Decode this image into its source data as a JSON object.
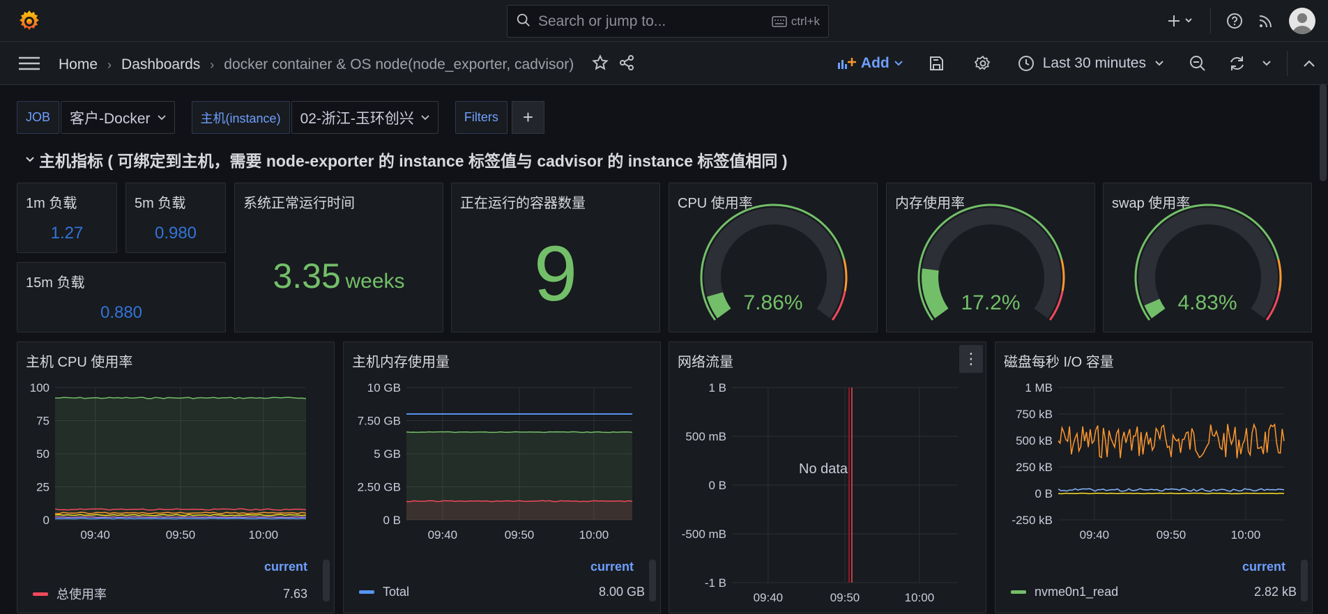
{
  "topbar": {
    "search_placeholder": "Search or jump to...",
    "search_shortcut": "ctrl+k"
  },
  "breadcrumb": {
    "home": "Home",
    "dashboards": "Dashboards",
    "current": "docker container & OS node(node_exporter, cadvisor)"
  },
  "toolbar": {
    "add_label": "Add",
    "time_range": "Last 30 minutes"
  },
  "variables": {
    "job_label": "JOB",
    "job_value": "客户-Docker",
    "instance_label": "主机(instance)",
    "instance_value": "02-浙江-玉环创兴",
    "filters_label": "Filters"
  },
  "row": {
    "title": "主机指标 ( 可绑定到主机，需要 node-exporter 的 instance 标签值与 cadvisor 的 instance 标签值相同 )"
  },
  "stats": {
    "load1": {
      "title": "1m 负载",
      "value": "1.27"
    },
    "load5": {
      "title": "5m 负载",
      "value": "0.980"
    },
    "load15": {
      "title": "15m 负载",
      "value": "0.880"
    },
    "uptime": {
      "title": "系统正常运行时间",
      "value": "3.35",
      "unit": "weeks"
    },
    "containers": {
      "title": "正在运行的容器数量",
      "value": "9"
    },
    "cpu": {
      "title": "CPU 使用率",
      "value": "7.86%",
      "level": 7.86
    },
    "mem": {
      "title": "内存使用率",
      "value": "17.2%",
      "level": 17.2
    },
    "swap": {
      "title": "swap 使用率",
      "value": "4.83%",
      "level": 4.83
    }
  },
  "panels": {
    "cpu": {
      "title": "主机 CPU 使用率",
      "yticks": [
        "100",
        "75",
        "50",
        "25",
        "0"
      ],
      "xticks": [
        "09:40",
        "09:50",
        "10:00"
      ],
      "legend_header": "current",
      "legend_name": "总使用率",
      "legend_value": "7.63"
    },
    "mem": {
      "title": "主机内存使用量",
      "yticks": [
        "10 GB",
        "7.50 GB",
        "5 GB",
        "2.50 GB",
        "0 B"
      ],
      "xticks": [
        "09:40",
        "09:50",
        "10:00"
      ],
      "legend_header": "current",
      "legend_name": "Total",
      "legend_value": "8.00 GB"
    },
    "net": {
      "title": "网络流量",
      "yticks": [
        "1 B",
        "500 mB",
        "0 B",
        "-500 mB",
        "-1 B"
      ],
      "xticks": [
        "09:40",
        "09:50",
        "10:00"
      ],
      "nodata": "No data"
    },
    "disk": {
      "title": "磁盘每秒 I/O 容量",
      "yticks": [
        "1 MB",
        "750 kB",
        "500 kB",
        "250 kB",
        "0 B",
        "-250 kB"
      ],
      "xticks": [
        "09:40",
        "09:50",
        "10:00"
      ],
      "legend_header": "current",
      "legend_name": "nvme0n1_read",
      "legend_value": "2.82 kB"
    }
  },
  "colors": {
    "accent": "#6e9fff",
    "green": "#73bf69",
    "red": "#f2495c",
    "blue": "#5794f2",
    "orange": "#ff9830",
    "yellow": "#fade2a",
    "cyan": "#8ab8ff"
  },
  "chart_data": [
    {
      "type": "line",
      "title": "主机 CPU 使用率",
      "x": [
        "09:40",
        "09:50",
        "10:00"
      ],
      "ylim": [
        0,
        100
      ],
      "series": [
        {
          "name": "总使用率",
          "values": [
            8,
            8,
            8
          ]
        }
      ]
    },
    {
      "type": "area",
      "title": "主机内存使用量",
      "x": [
        "09:40",
        "09:50",
        "10:00"
      ],
      "ylim": [
        0,
        10
      ],
      "series": [
        {
          "name": "Total",
          "values": [
            8,
            8,
            8
          ]
        }
      ]
    },
    {
      "type": "line",
      "title": "磁盘每秒 I/O 容量",
      "x": [
        "09:40",
        "09:50",
        "10:00"
      ],
      "ylim": [
        -250,
        1000
      ],
      "series": [
        {
          "name": "nvme0n1_read",
          "values": [
            40,
            40,
            40
          ]
        }
      ]
    }
  ]
}
